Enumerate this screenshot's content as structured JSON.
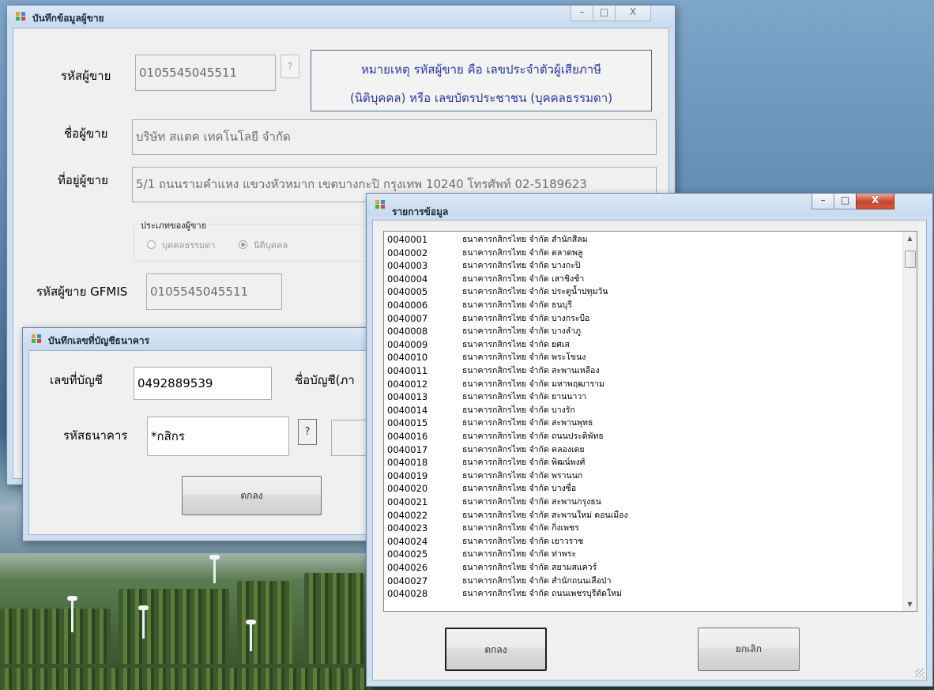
{
  "colors": {
    "note_text": "#2a35a8",
    "title_text": "#1b2a3c",
    "window_frame": "#cfdff0"
  },
  "seller_form": {
    "title": "บันทึกข้อมูลผู้ขาย",
    "controls": {
      "minimize": "–",
      "maximize": "□",
      "close": "X"
    },
    "seller_code_label": "รหัสผู้ขาย",
    "seller_code_value": "0105545045511",
    "lookup_button": "?",
    "note_line1": "หมายเหตุ รหัสผู้ขาย  คือ  เลขประจำตัวผู้เสียภาษี",
    "note_line2": "(นิติบุคคล) หรือ เลขบัตรประชาชน (บุคคลธรรมดา)",
    "seller_name_label": "ชื่อผู้ขาย",
    "seller_name_value": "บริษัท สแตค เทคโนโลยี จำกัด",
    "seller_address_label": "ที่อยู่ผู้ขาย",
    "seller_address_value": "5/1 ถนนรามคำแหง แขวงหัวหมาก  เขตบางกะปิ  กรุงเทพ 10240 โทรศัพท์ 02-5189623",
    "seller_type_group": "ประเภทของผู้ขาย",
    "type_person": "บุคคลธรรมดา",
    "type_juristic": "นิติบุคคล",
    "gfmis_label": "รหัสผู้ขาย GFMIS",
    "gfmis_value": "0105545045511"
  },
  "bank_form": {
    "title": "บันทึกเลขที่บัญชีธนาคาร",
    "account_no_label": "เลขที่บัญชี",
    "account_no_value": "0492889539",
    "account_name_label": "ชื่อบัญชี(ภา",
    "bank_code_label": "รหัสธนาคาร",
    "bank_code_value": "*กสิกร",
    "lookup_button": "?",
    "ok_button": "ตกลง"
  },
  "list_dialog": {
    "title": "รายการข้อมูล",
    "controls": {
      "minimize": "–",
      "maximize": "□",
      "close": "X"
    },
    "items": [
      {
        "code": "0040001",
        "name": "ธนาคารกสิกรไทย จำกัด  สำนักสีลม"
      },
      {
        "code": "0040002",
        "name": "ธนาคารกสิกรไทย จำกัด  ตลาดพลู"
      },
      {
        "code": "0040003",
        "name": "ธนาคารกสิกรไทย จำกัด  บางกะปิ"
      },
      {
        "code": "0040004",
        "name": "ธนาคารกสิกรไทย จำกัด  เสาชิงช้า"
      },
      {
        "code": "0040005",
        "name": "ธนาคารกสิกรไทย จำกัด  ประตูน้ำปทุมวัน"
      },
      {
        "code": "0040006",
        "name": "ธนาคารกสิกรไทย จำกัด  ธนบุรี"
      },
      {
        "code": "0040007",
        "name": "ธนาคารกสิกรไทย จำกัด  บางกระบือ"
      },
      {
        "code": "0040008",
        "name": "ธนาคารกสิกรไทย จำกัด  บางลำภู"
      },
      {
        "code": "0040009",
        "name": "ธนาคารกสิกรไทย จำกัด  ยศเส"
      },
      {
        "code": "0040010",
        "name": "ธนาคารกสิกรไทย จำกัด  พระโขนง"
      },
      {
        "code": "0040011",
        "name": "ธนาคารกสิกรไทย จำกัด  สะพานเหลือง"
      },
      {
        "code": "0040012",
        "name": "ธนาคารกสิกรไทย จำกัด  มหาพฤฒาราม"
      },
      {
        "code": "0040013",
        "name": "ธนาคารกสิกรไทย จำกัด  ยานนาวา"
      },
      {
        "code": "0040014",
        "name": "ธนาคารกสิกรไทย จำกัด  บางรัก"
      },
      {
        "code": "0040015",
        "name": "ธนาคารกสิกรไทย จำกัด  สะพานพุทธ"
      },
      {
        "code": "0040016",
        "name": "ธนาคารกสิกรไทย จำกัด  ถนนประดิพัทธ"
      },
      {
        "code": "0040017",
        "name": "ธนาคารกสิกรไทย จำกัด  คลองเตย"
      },
      {
        "code": "0040018",
        "name": "ธนาคารกสิกรไทย จำกัด  พิฒน์พงศ์"
      },
      {
        "code": "0040019",
        "name": "ธนาคารกสิกรไทย จำกัด  พรานนก"
      },
      {
        "code": "0040020",
        "name": "ธนาคารกสิกรไทย จำกัด  บางซื่อ"
      },
      {
        "code": "0040021",
        "name": "ธนาคารกสิกรไทย จำกัด  สะพานกรุงธน"
      },
      {
        "code": "0040022",
        "name": "ธนาคารกสิกรไทย จำกัด  สะพานใหม่ ดอนเมือง"
      },
      {
        "code": "0040023",
        "name": "ธนาคารกสิกรไทย จำกัด  กิ่งเพชร"
      },
      {
        "code": "0040024",
        "name": "ธนาคารกสิกรไทย จำกัด  เยาวราช"
      },
      {
        "code": "0040025",
        "name": "ธนาคารกสิกรไทย จำกัด  ท่าพระ"
      },
      {
        "code": "0040026",
        "name": "ธนาคารกสิกรไทย จำกัด  สยามสแควร์"
      },
      {
        "code": "0040027",
        "name": "ธนาคารกสิกรไทย จำกัด  สำนักถนนเสือป่า"
      },
      {
        "code": "0040028",
        "name": "ธนาคารกสิกรไทย จำกัด  ถนนเพชรบุรีตัดใหม่"
      }
    ],
    "ok_button": "ตกลง",
    "cancel_button": "ยกเลิก"
  }
}
